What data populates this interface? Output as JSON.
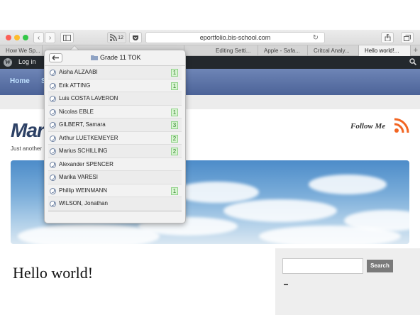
{
  "browser": {
    "address": "eportfolio.bis-school.com",
    "rss_badge_count": "12",
    "tabs": [
      {
        "label": "How We Sp..."
      },
      {
        "label": "Editing Setti..."
      },
      {
        "label": "Apple - Safa..."
      },
      {
        "label": "Critcal Analy..."
      },
      {
        "label": "Hello world!..."
      }
    ]
  },
  "adminbar": {
    "login": "Log in"
  },
  "nav": {
    "home": "Home",
    "second": "S"
  },
  "site": {
    "title": "Mar",
    "tagline": "Just another",
    "follow": "Follow Me",
    "post_title": "Hello world!"
  },
  "sidebar": {
    "search_button": "Search",
    "search_placeholder": ""
  },
  "popover": {
    "title": "Grade 11 TOK",
    "students": [
      {
        "name": "Aisha ALZAABI",
        "count": "1"
      },
      {
        "name": "Erik ATTING",
        "count": "1"
      },
      {
        "name": "Luis COSTA LAVERON",
        "count": ""
      },
      {
        "name": "Nicolas EBLE",
        "count": "1"
      },
      {
        "name": "GILBERT, Samara",
        "count": "3"
      },
      {
        "name": "Arthur LUETKEMEYER",
        "count": "2"
      },
      {
        "name": "Marius SCHILLING",
        "count": "2"
      },
      {
        "name": "Alexander SPENCER",
        "count": ""
      },
      {
        "name": "Marika VARESI",
        "count": ""
      },
      {
        "name": "Phillip WEINMANN",
        "count": "1"
      },
      {
        "name": "WILSON, Jonathan",
        "count": ""
      }
    ]
  },
  "colors": {
    "nav_blue": "#5a71a6",
    "title_navy": "#2d4165",
    "rss_orange": "#f26522",
    "badge_green": "#8fd187"
  }
}
